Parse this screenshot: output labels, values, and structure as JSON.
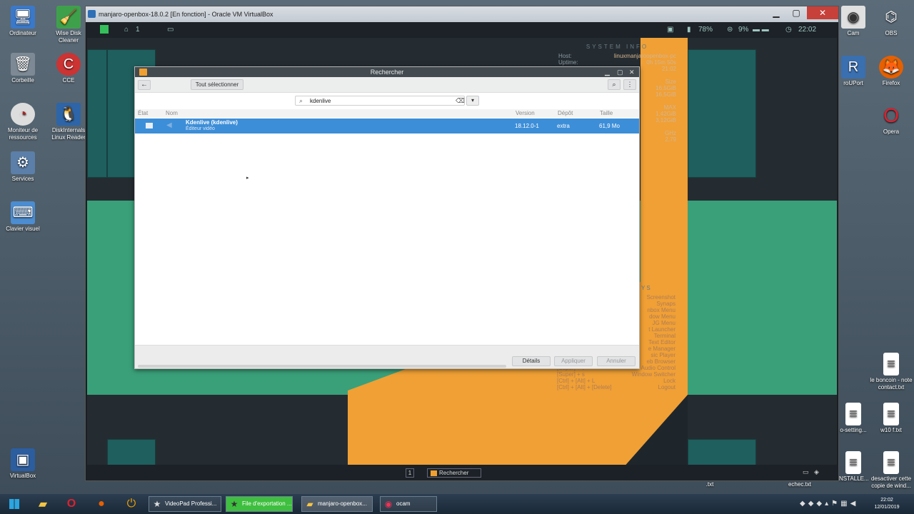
{
  "host_desktop": {
    "left_icons": [
      {
        "label": "Ordinateur",
        "icon": "computer-icon"
      },
      {
        "label": "Wise Disk Cleaner",
        "icon": "disk-cleaner-icon"
      },
      {
        "label": "Corbeille",
        "icon": "recycle-bin-icon"
      },
      {
        "label": "CCE",
        "icon": "cce-icon"
      },
      {
        "label": "Moniteur de ressources",
        "icon": "monitor-gauge-icon"
      },
      {
        "label": "DiskInternals Linux Reader",
        "icon": "linux-reader-icon"
      },
      {
        "label": "Services",
        "icon": "gears-icon"
      },
      {
        "label": "Clavier visuel",
        "icon": "keyboard-icon"
      },
      {
        "label": "VirtualBox",
        "icon": "virtualbox-icon"
      }
    ],
    "right_icons": [
      {
        "label": "Cam"
      },
      {
        "label": "OBS"
      },
      {
        "label": "roUPort"
      },
      {
        "label": "Firefox"
      },
      {
        "label": "Opera"
      },
      {
        "label": "le boncoin - note contact.txt"
      },
      {
        "label": "o-setting..."
      },
      {
        "label": "w10 f.txt"
      },
      {
        "label": "NSTALLE..."
      },
      {
        "label": "desactiver cette copie de wind..."
      },
      {
        "label": ".txt"
      },
      {
        "label": "echec.txt"
      }
    ]
  },
  "vbox_window": {
    "title": "manjaro-openbox-18.0.2 [En fonction] - Oracle VM VirtualBox"
  },
  "guest": {
    "topbar": {
      "workspace": "1",
      "battery": "78%",
      "cpu": "9%",
      "clock": "22:02"
    },
    "sysinfo": {
      "header": "SYSTEM  INFO",
      "host_label": "Host:",
      "host_value": "linuxmanjaroopenbox-pc",
      "uptime_label": "Uptime:",
      "uptime_value": "0h 15m 50s",
      "time": "21:02",
      "size_label": "Size",
      "size_1": "16,5GiB",
      "size_2": "16,5GiB",
      "max_label": "MAX",
      "max_1": "1,42GiB",
      "max_2": "3,12GiB",
      "ghz_label": "GHz",
      "ghz_value": "2,79"
    },
    "keys": {
      "header": "YS",
      "lines": [
        "Screenshot",
        "Synaps",
        "nbox Menu",
        "dow Menu",
        "JG Menu",
        "t Launcher",
        "Terminal",
        "Text Editor",
        "e Manager",
        "sic Player",
        "eb Browser",
        "Audio Control",
        "Window Switcher",
        "Lock",
        "Logout"
      ],
      "left_lines": [
        "[Super] + v",
        "[Super] + s",
        "[Ctrl] + [Alt] + L",
        "[Ctrl] + [Alt] + [Delete]"
      ]
    },
    "taskbar": {
      "workspace": "1",
      "task": "Rechercher"
    }
  },
  "dialog": {
    "title": "Rechercher",
    "select_all": "Tout sélectionner",
    "search_value": "kdenlive",
    "columns": {
      "state": "État",
      "name": "Nom",
      "version": "Version",
      "repo": "Dépôt",
      "size": "Taille"
    },
    "row": {
      "name": "Kdenlive  (kdenlive)",
      "desc": "Éditeur vidéo",
      "version": "18.12.0-1",
      "repo": "extra",
      "size": "61,9 Mo"
    },
    "footer": {
      "details": "Détails",
      "apply": "Appliquer",
      "cancel": "Annuler"
    }
  },
  "taskbar": {
    "tasks": [
      "VideoPad Professi...",
      "File d'exportation ...",
      "manjaro-openbox...",
      "ocam"
    ],
    "time": "22:02",
    "date": "12/01/2019"
  }
}
